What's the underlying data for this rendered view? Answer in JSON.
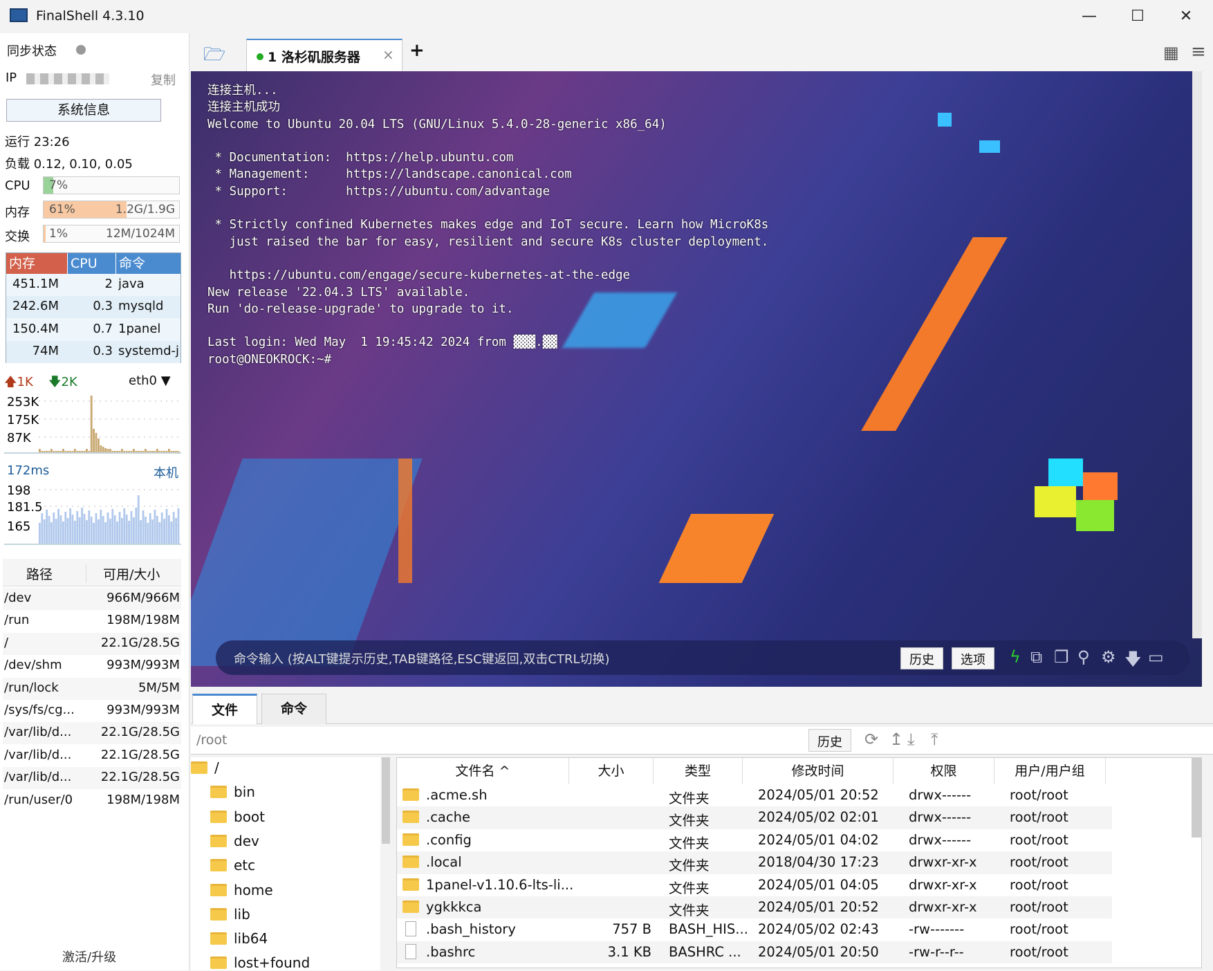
{
  "window": {
    "title": "FinalShell 4.3.10",
    "minimize": "—",
    "maximize": "☐",
    "close": "✕"
  },
  "sidebar": {
    "sync_label": "同步状态",
    "ip_label": "IP",
    "copy": "复制",
    "sysinfo": "系统信息",
    "uptime": "运行 23:26",
    "load": "负载 0.12, 0.10, 0.05",
    "cpu": {
      "label": "CPU",
      "percent": "7%",
      "value": 7
    },
    "mem": {
      "label": "内存",
      "percent": "61%",
      "detail": "1.2G/1.9G",
      "value": 61
    },
    "swap": {
      "label": "交换",
      "percent": "1%",
      "detail": "12M/1024M",
      "value": 1
    },
    "proc_headers": [
      "内存",
      "CPU",
      "命令"
    ],
    "procs": [
      {
        "mem": "451.1M",
        "cpu": "2",
        "cmd": "java"
      },
      {
        "mem": "242.6M",
        "cpu": "0.3",
        "cmd": "mysqld"
      },
      {
        "mem": "150.4M",
        "cpu": "0.7",
        "cmd": "1panel"
      },
      {
        "mem": "74M",
        "cpu": "0.3",
        "cmd": "systemd-j."
      }
    ],
    "net": {
      "up": "1K",
      "down": "2K",
      "iface": "eth0",
      "ticks": [
        "253K",
        "175K",
        "87K"
      ]
    },
    "latency": {
      "value": "172ms",
      "target": "本机",
      "ticks": [
        "198",
        "181.5",
        "165"
      ]
    },
    "disk_headers": [
      "路径",
      "可用/大小"
    ],
    "disks": [
      [
        "/dev",
        "966M/966M"
      ],
      [
        "/run",
        "198M/198M"
      ],
      [
        "/",
        "22.1G/28.5G"
      ],
      [
        "/dev/shm",
        "993M/993M"
      ],
      [
        "/run/lock",
        "5M/5M"
      ],
      [
        "/sys/fs/cg...",
        "993M/993M"
      ],
      [
        "/var/lib/d...",
        "22.1G/28.5G"
      ],
      [
        "/var/lib/d...",
        "22.1G/28.5G"
      ],
      [
        "/var/lib/d...",
        "22.1G/28.5G"
      ],
      [
        "/run/user/0",
        "198M/198M"
      ]
    ],
    "activate": "激活/升级"
  },
  "tabs": [
    {
      "label": "1 洛杉矶服务器",
      "status_color": "#22aa22"
    }
  ],
  "terminal": {
    "text": "连接主机...\n连接主机成功\nWelcome to Ubuntu 20.04 LTS (GNU/Linux 5.4.0-28-generic x86_64)\n\n * Documentation:  https://help.ubuntu.com\n * Management:     https://landscape.canonical.com\n * Support:        https://ubuntu.com/advantage\n\n * Strictly confined Kubernetes makes edge and IoT secure. Learn how MicroK8s\n   just raised the bar for easy, resilient and secure K8s cluster deployment.\n\n   https://ubuntu.com/engage/secure-kubernetes-at-the-edge\nNew release '22.04.3 LTS' available.\nRun 'do-release-upgrade' to upgrade to it.\n\nLast login: Wed May  1 19:45:42 2024 from ▓▓▓.▓▓\nroot@ONEOKROCK:~#"
  },
  "cmdbar": {
    "placeholder": "命令输入 (按ALT键提示历史,TAB键路径,ESC键返回,双击CTRL切换)",
    "history": "历史",
    "options": "选项"
  },
  "bottom_tabs": [
    "文件",
    "命令"
  ],
  "filebar": {
    "path": "/root",
    "history": "历史"
  },
  "tree": [
    "/",
    "bin",
    "boot",
    "dev",
    "etc",
    "home",
    "lib",
    "lib64",
    "lost+found"
  ],
  "files": {
    "headers": [
      "文件名 ^",
      "大小",
      "类型",
      "修改时间",
      "权限",
      "用户/用户组"
    ],
    "rows": [
      {
        "name": ".acme.sh",
        "size": "",
        "type": "文件夹",
        "time": "2024/05/01 20:52",
        "perm": "drwx------",
        "owner": "root/root",
        "dir": true
      },
      {
        "name": ".cache",
        "size": "",
        "type": "文件夹",
        "time": "2024/05/02 02:01",
        "perm": "drwx------",
        "owner": "root/root",
        "dir": true
      },
      {
        "name": ".config",
        "size": "",
        "type": "文件夹",
        "time": "2024/05/01 04:02",
        "perm": "drwx------",
        "owner": "root/root",
        "dir": true
      },
      {
        "name": ".local",
        "size": "",
        "type": "文件夹",
        "time": "2018/04/30 17:23",
        "perm": "drwxr-xr-x",
        "owner": "root/root",
        "dir": true
      },
      {
        "name": "1panel-v1.10.6-lts-li...",
        "size": "",
        "type": "文件夹",
        "time": "2024/05/01 04:05",
        "perm": "drwxr-xr-x",
        "owner": "root/root",
        "dir": true
      },
      {
        "name": "ygkkkca",
        "size": "",
        "type": "文件夹",
        "time": "2024/05/01 20:52",
        "perm": "drwxr-xr-x",
        "owner": "root/root",
        "dir": true
      },
      {
        "name": ".bash_history",
        "size": "757 B",
        "type": "BASH_HIS...",
        "time": "2024/05/02 02:43",
        "perm": "-rw-------",
        "owner": "root/root",
        "dir": false
      },
      {
        "name": ".bashrc",
        "size": "3.1 KB",
        "type": "BASHRC ...",
        "time": "2024/05/01 20:50",
        "perm": "-rw-r--r--",
        "owner": "root/root",
        "dir": false
      }
    ]
  }
}
